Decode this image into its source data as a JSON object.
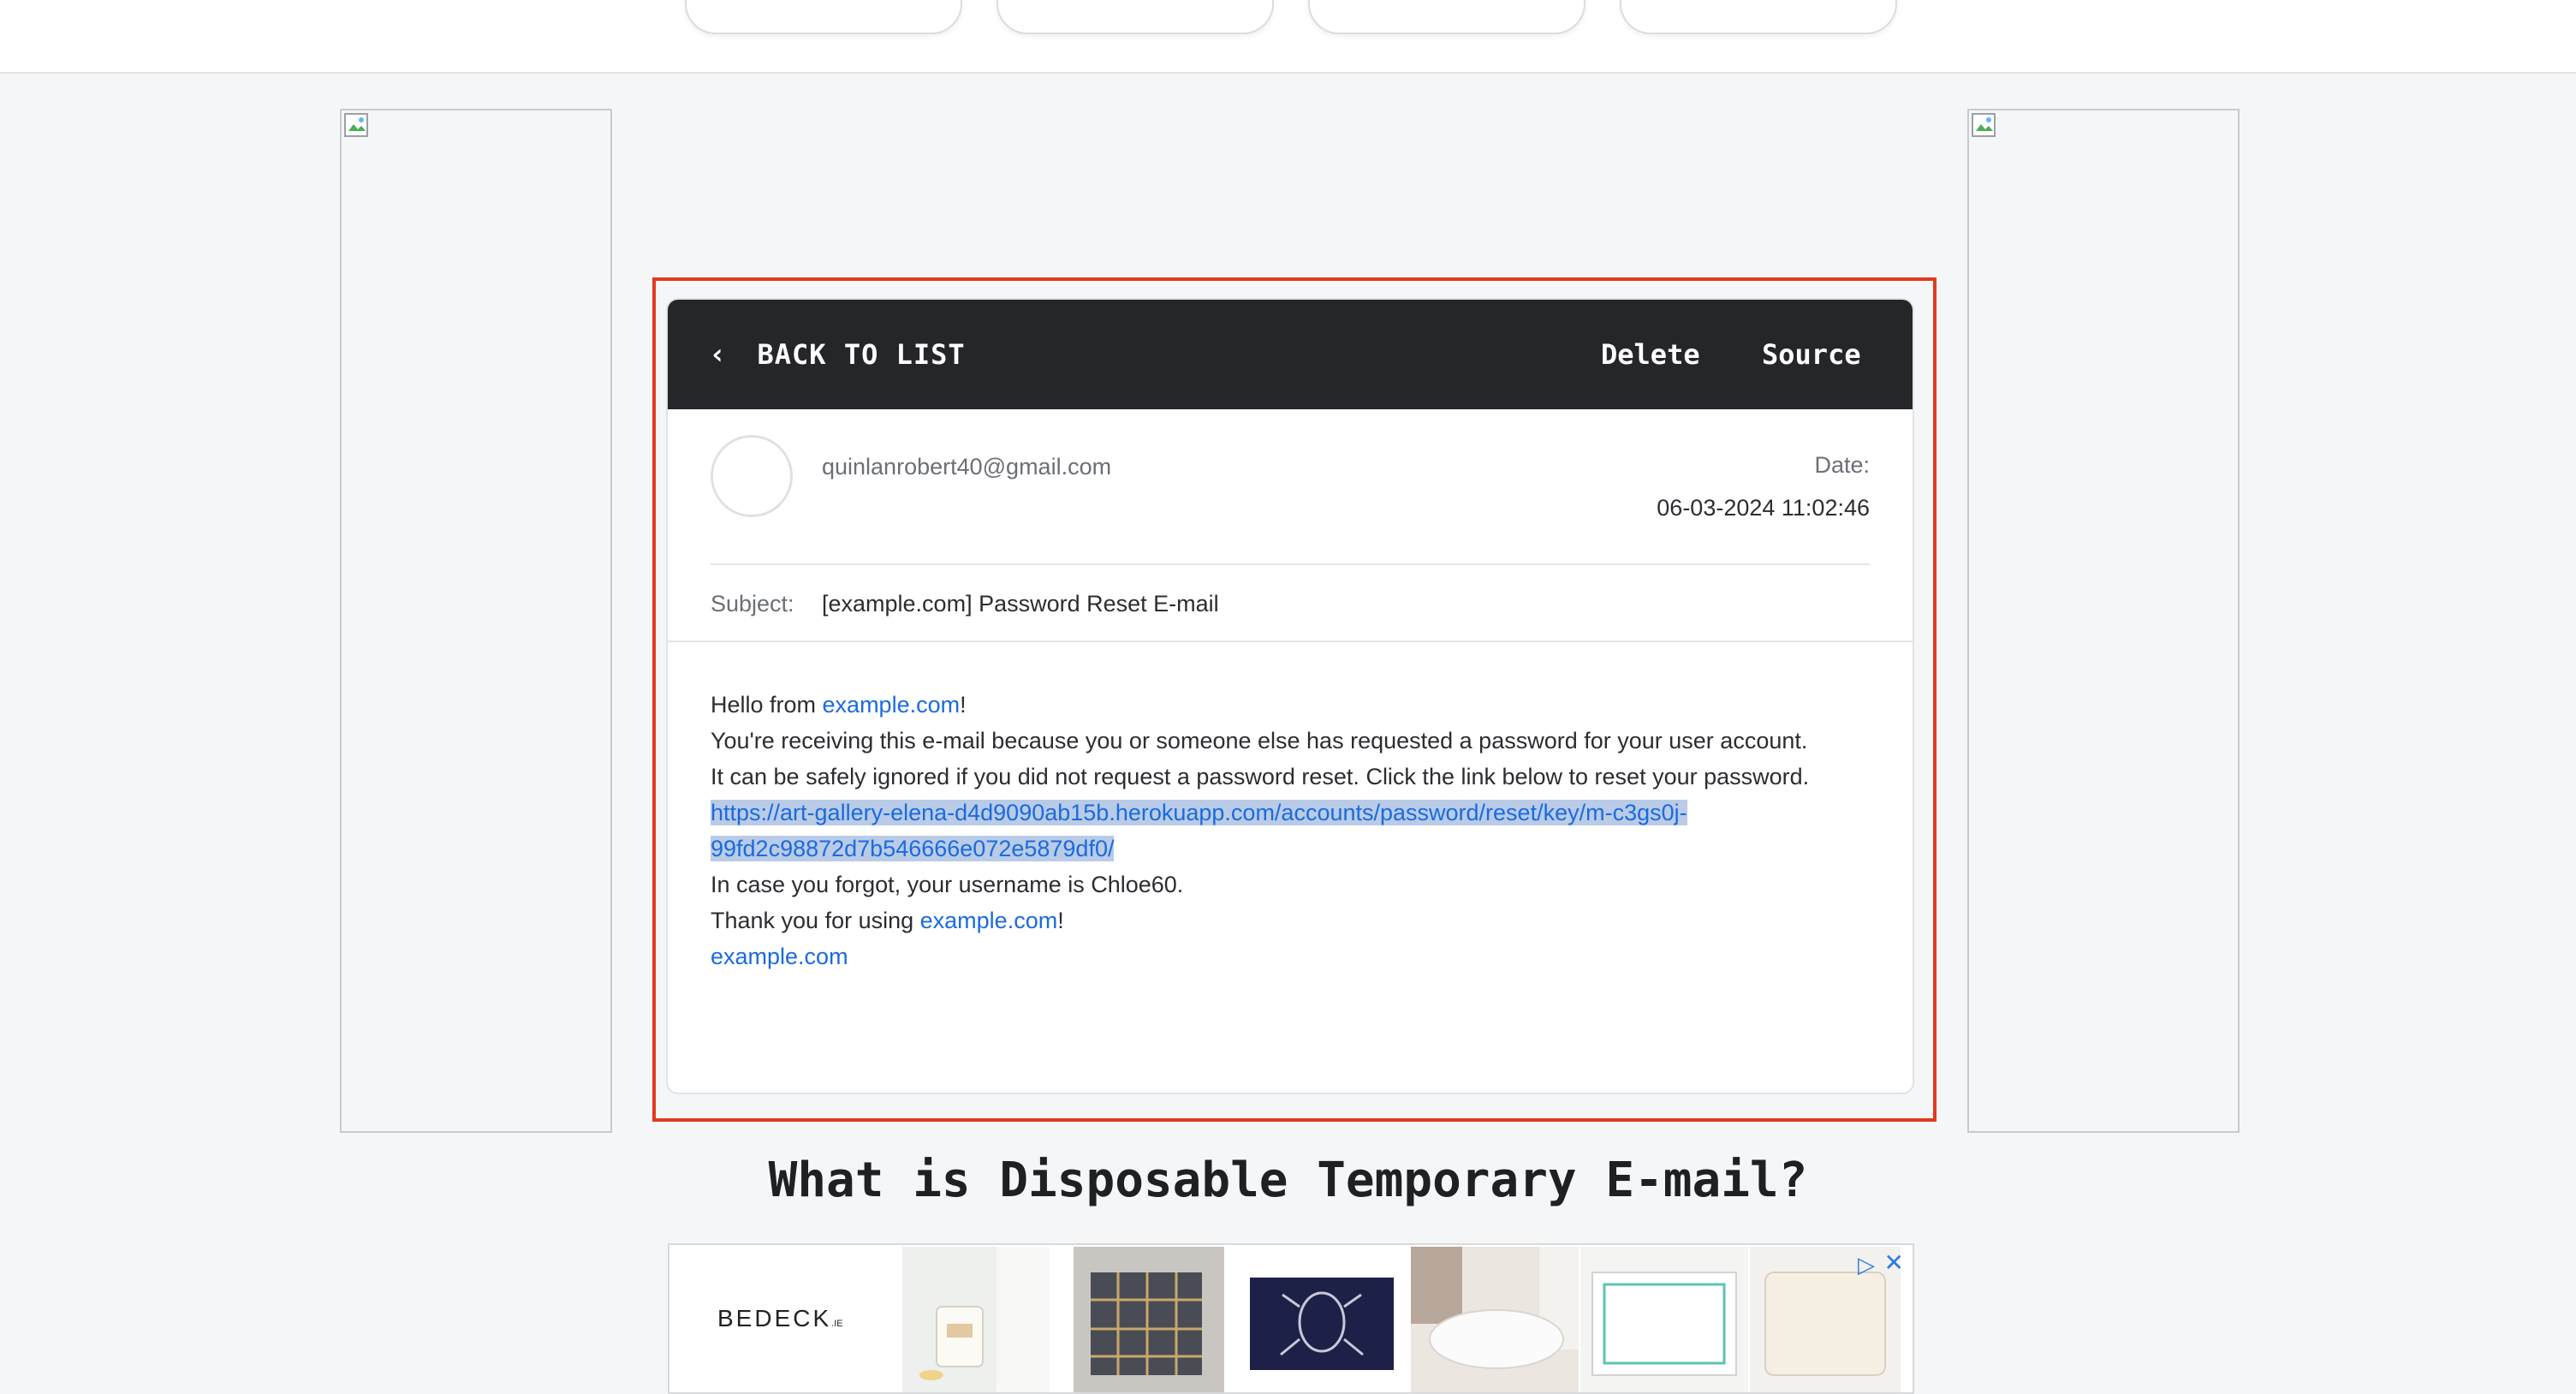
{
  "mail": {
    "back_label": "BACK TO LIST",
    "delete_label": "Delete",
    "source_label": "Source",
    "from": "quinlanrobert40@gmail.com",
    "date_label": "Date:",
    "date_value": "06-03-2024 11:02:46",
    "subject_label": "Subject:",
    "subject_value": "[example.com] Password Reset E-mail",
    "body": {
      "hello_prefix": "Hello from ",
      "hello_link": "example.com",
      "hello_suffix": "!",
      "line2": "You're receiving this e-mail because you or someone else has requested a password for your user account.",
      "line3": "It can be safely ignored if you did not request a password reset. Click the link below to reset your password.",
      "reset_link_part1": "https://art-gallery-elena-d4d9090ab15b.herokuapp.com/accounts/password/reset/key/m-c3gs0j-",
      "reset_link_part2": "99fd2c98872d7b546666e072e5879df0/",
      "line5": "In case you forgot, your username is Chloe60.",
      "thanks_prefix": "Thank you for using ",
      "thanks_link": "example.com",
      "thanks_suffix": "!",
      "sign_link": "example.com"
    }
  },
  "section_title": "What is Disposable Temporary E-mail?",
  "ad": {
    "brand": "BEDECK",
    "brand_suffix": ".IE",
    "choice_icon": "▷",
    "close_icon": "✕"
  },
  "colors": {
    "header_bg": "#25262a",
    "link": "#1a6be0",
    "highlight": "#e23a1f",
    "selection": "#b9cbe6"
  }
}
